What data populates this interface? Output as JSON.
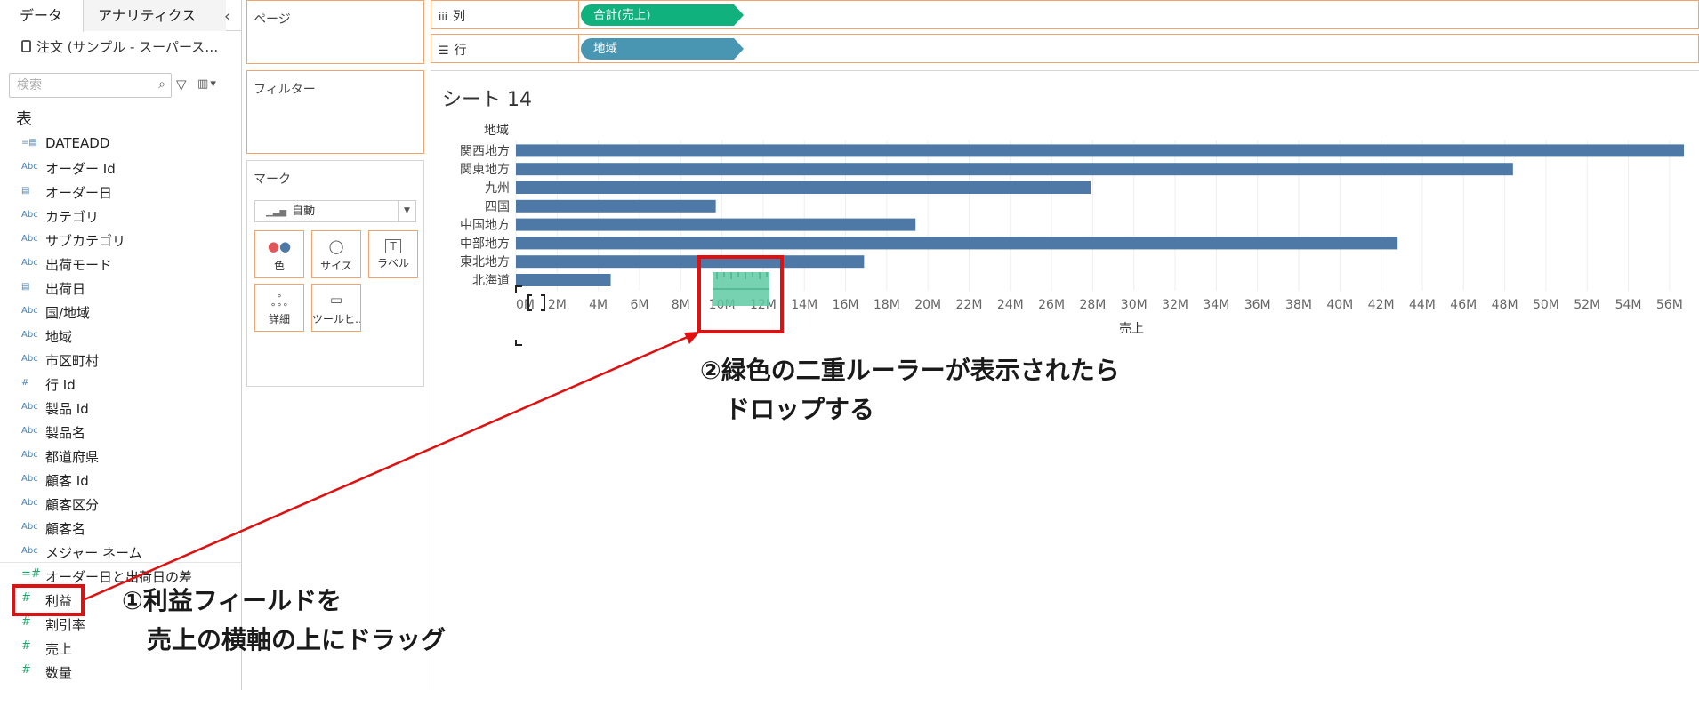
{
  "data_pane": {
    "tabs": [
      "データ",
      "アナリティクス"
    ],
    "datasource": "注文 (サンプル - スーパース…",
    "search_placeholder": "検索",
    "table_heading": "表",
    "fields": [
      {
        "icon": "date-calc",
        "label": "DATEADD",
        "type": "dimension"
      },
      {
        "icon": "Abc",
        "label": "オーダー Id",
        "type": "dimension"
      },
      {
        "icon": "date",
        "label": "オーダー日",
        "type": "dimension"
      },
      {
        "icon": "Abc",
        "label": "カテゴリ",
        "type": "dimension"
      },
      {
        "icon": "Abc",
        "label": "サブカテゴリ",
        "type": "dimension"
      },
      {
        "icon": "Abc",
        "label": "出荷モード",
        "type": "dimension"
      },
      {
        "icon": "date",
        "label": "出荷日",
        "type": "dimension"
      },
      {
        "icon": "Abc",
        "label": "国/地域",
        "type": "dimension"
      },
      {
        "icon": "Abc",
        "label": "地域",
        "type": "dimension"
      },
      {
        "icon": "Abc",
        "label": "市区町村",
        "type": "dimension"
      },
      {
        "icon": "#",
        "label": "行 Id",
        "type": "dimension"
      },
      {
        "icon": "Abc",
        "label": "製品 Id",
        "type": "dimension"
      },
      {
        "icon": "Abc",
        "label": "製品名",
        "type": "dimension"
      },
      {
        "icon": "Abc",
        "label": "都道府県",
        "type": "dimension"
      },
      {
        "icon": "Abc",
        "label": "顧客 Id",
        "type": "dimension"
      },
      {
        "icon": "Abc",
        "label": "顧客区分",
        "type": "dimension"
      },
      {
        "icon": "Abc",
        "label": "顧客名",
        "type": "dimension"
      },
      {
        "icon": "Abc",
        "label": "メジャー ネーム",
        "type": "dimension"
      },
      {
        "icon": "=#",
        "label": "オーダー日と出荷日の差",
        "type": "measure"
      },
      {
        "icon": "#",
        "label": "利益",
        "type": "measure"
      },
      {
        "icon": "#",
        "label": "割引率",
        "type": "measure"
      },
      {
        "icon": "#",
        "label": "売上",
        "type": "measure"
      },
      {
        "icon": "#",
        "label": "数量",
        "type": "measure"
      }
    ]
  },
  "cards": {
    "pages": "ページ",
    "filters": "フィルター",
    "marks": "マーク",
    "mark_type": "自動",
    "mark_buttons": [
      "色",
      "サイズ",
      "ラベル",
      "詳細",
      "ツールヒ…"
    ]
  },
  "shelves": {
    "columns_label": "列",
    "columns_pill": "合計(売上)",
    "rows_label": "行",
    "rows_pill": "地域"
  },
  "sheet_title": "シート 14",
  "chart_data": {
    "type": "bar",
    "orientation": "horizontal",
    "category_header": "地域",
    "categories": [
      "関西地方",
      "関東地方",
      "九州",
      "四国",
      "中国地方",
      "中部地方",
      "東北地方",
      "北海道"
    ],
    "values": [
      56.7,
      48.4,
      27.9,
      9.7,
      19.4,
      42.8,
      16.9,
      4.6
    ],
    "unit": "M",
    "xlabel": "売上",
    "xlim": [
      0,
      57
    ],
    "x_ticks": [
      "0M",
      "2M",
      "4M",
      "6M",
      "8M",
      "10M",
      "12M",
      "14M",
      "16M",
      "18M",
      "20M",
      "22M",
      "24M",
      "26M",
      "28M",
      "30M",
      "32M",
      "34M",
      "36M",
      "38M",
      "40M",
      "42M",
      "44M",
      "46M",
      "48M",
      "50M",
      "52M",
      "54M",
      "56M"
    ],
    "grid": "vertical",
    "bar_color": "#4e79a7"
  },
  "annotations": {
    "note1_line1": "①利益フィールドを",
    "note1_line2": "　売上の横軸の上にドラッグ",
    "note2_line1": "②緑色の二重ルーラーが表示されたら",
    "note2_line2": "　ドロップする"
  },
  "colors": {
    "highlight": "#e01010",
    "drop_ruler": "#5fcaa4",
    "accent_border": "#f0a46e"
  }
}
